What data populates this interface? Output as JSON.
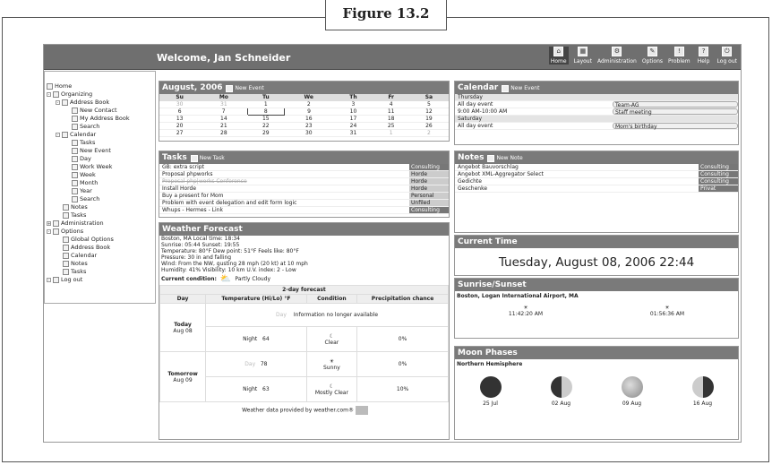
{
  "figure": {
    "caption": "Figure 13.2"
  },
  "header": {
    "welcome": "Welcome, Jan Schneider",
    "nav": [
      {
        "label": "Home",
        "icon": "home-icon"
      },
      {
        "label": "Layout",
        "icon": "layout-icon"
      },
      {
        "label": "Administration",
        "icon": "admin-icon"
      },
      {
        "label": "Options",
        "icon": "options-icon"
      },
      {
        "label": "Problem",
        "icon": "problem-icon"
      },
      {
        "label": "Help",
        "icon": "help-icon"
      },
      {
        "label": "Log out",
        "icon": "logout-icon"
      }
    ]
  },
  "sidebar": {
    "items": [
      {
        "label": "Home"
      },
      {
        "label": "Organizing"
      },
      {
        "label": "Address Book"
      },
      {
        "label": "New Contact"
      },
      {
        "label": "My Address Book"
      },
      {
        "label": "Search"
      },
      {
        "label": "Calendar"
      },
      {
        "label": "Tasks"
      },
      {
        "label": "New Event"
      },
      {
        "label": "Day"
      },
      {
        "label": "Work Week"
      },
      {
        "label": "Week"
      },
      {
        "label": "Month"
      },
      {
        "label": "Year"
      },
      {
        "label": "Search"
      },
      {
        "label": "Notes"
      },
      {
        "label": "Tasks"
      },
      {
        "label": "Administration"
      },
      {
        "label": "Options"
      },
      {
        "label": "Global Options"
      },
      {
        "label": "Address Book"
      },
      {
        "label": "Calendar"
      },
      {
        "label": "Notes"
      },
      {
        "label": "Tasks"
      },
      {
        "label": "Log out"
      }
    ]
  },
  "month_calendar": {
    "title": "August, 2006",
    "new_event": "New Event",
    "days": [
      "Su",
      "Mo",
      "Tu",
      "We",
      "Th",
      "Fr",
      "Sa"
    ],
    "weeks": [
      [
        "30",
        "31",
        "1",
        "2",
        "3",
        "4",
        "5"
      ],
      [
        "6",
        "7",
        "8",
        "9",
        "10",
        "11",
        "12"
      ],
      [
        "13",
        "14",
        "15",
        "16",
        "17",
        "18",
        "19"
      ],
      [
        "20",
        "21",
        "22",
        "23",
        "24",
        "25",
        "26"
      ],
      [
        "27",
        "28",
        "29",
        "30",
        "31",
        "1",
        "2"
      ]
    ]
  },
  "tasks": {
    "title": "Tasks",
    "new_task": "New Task",
    "rows": [
      {
        "label": "GB: extra script",
        "tag": "Consulting"
      },
      {
        "label": "Proposal phpworks",
        "tag": "Horde"
      },
      {
        "label": "Proposal php|works Conference",
        "tag": "Horde"
      },
      {
        "label": "Install Horde",
        "tag": "Horde"
      },
      {
        "label": "Buy a present for Mom",
        "tag": "Personal"
      },
      {
        "label": "Problem with event delegation and edit form logic",
        "tag": "Unfiled"
      },
      {
        "label": "Whups - Hermes - Link",
        "tag": "Consulting"
      }
    ]
  },
  "weather": {
    "title": "Weather Forecast",
    "lines": [
      "Boston, MA Local time: 18:34",
      "Sunrise: 05:44 Sunset: 19:55",
      "Temperature: 80°F Dew point: 51°F Feels like: 80°F",
      "Pressure: 30 in and falling",
      "Wind: From the NW, gusting 28 mph (20 kt) at 10 mph",
      "Humidity: 41% Visibility: 10 km U.V. index: 2 - Low"
    ],
    "condition_label": "Current condition:",
    "condition": "Partly Cloudy",
    "forecast_title": "2-day forecast",
    "headers": [
      "Day",
      "Temperature (Hi/Lo) °F",
      "Condition",
      "Precipitation chance"
    ],
    "today": "Today",
    "today_date": "Aug 08",
    "tomorrow": "Tomorrow",
    "tomorrow_date": "Aug 09",
    "day_label": "Day",
    "night_label": "Night",
    "no_info": "Information no longer available",
    "today_night": {
      "temp": "64",
      "cond": "Clear",
      "precip": "0%"
    },
    "tomorrow_day": {
      "temp": "78",
      "cond": "Sunny",
      "precip": "0%"
    },
    "tomorrow_night": {
      "temp": "63",
      "cond": "Mostly Clear",
      "precip": "10%"
    },
    "footer": "Weather data provided by weather.com®"
  },
  "upcoming": {
    "title": "Calendar",
    "new_event": "New Event",
    "rows": [
      {
        "label": "Thursday",
        "tag": "",
        "head": true
      },
      {
        "label": "All day event",
        "tag": "Team-AG",
        "head": false
      },
      {
        "label": "9:00 AM-10:00 AM",
        "tag": "Staff meeting",
        "head": false
      },
      {
        "label": "Saturday",
        "tag": "",
        "head": true
      },
      {
        "label": "All day event",
        "tag": "Mom's birthday",
        "head": false
      }
    ]
  },
  "notes": {
    "title": "Notes",
    "new_note": "New Note",
    "rows": [
      {
        "label": "Angebot Bauvorschlag",
        "tag": "Consulting"
      },
      {
        "label": "Angebot XML-Aggregator Select",
        "tag": "Consulting"
      },
      {
        "label": "Gedichte",
        "tag": "Consulting"
      },
      {
        "label": "Geschenke",
        "tag": "Privat"
      }
    ]
  },
  "current_time": {
    "title": "Current Time",
    "value": "Tuesday, August 08, 2006 22:44"
  },
  "sun": {
    "title": "Sunrise/Sunset",
    "location": "Boston, Logan International Airport, MA",
    "sunrise": "11:42:20 AM",
    "sunset": "01:56:36 AM"
  },
  "moon": {
    "title": "Moon Phases",
    "hemisphere": "Northern Hemisphere",
    "phases": [
      {
        "date": "25 Jul",
        "phase": "new"
      },
      {
        "date": "02 Aug",
        "phase": "first-quarter"
      },
      {
        "date": "09 Aug",
        "phase": "full"
      },
      {
        "date": "16 Aug",
        "phase": "last-quarter"
      }
    ]
  }
}
